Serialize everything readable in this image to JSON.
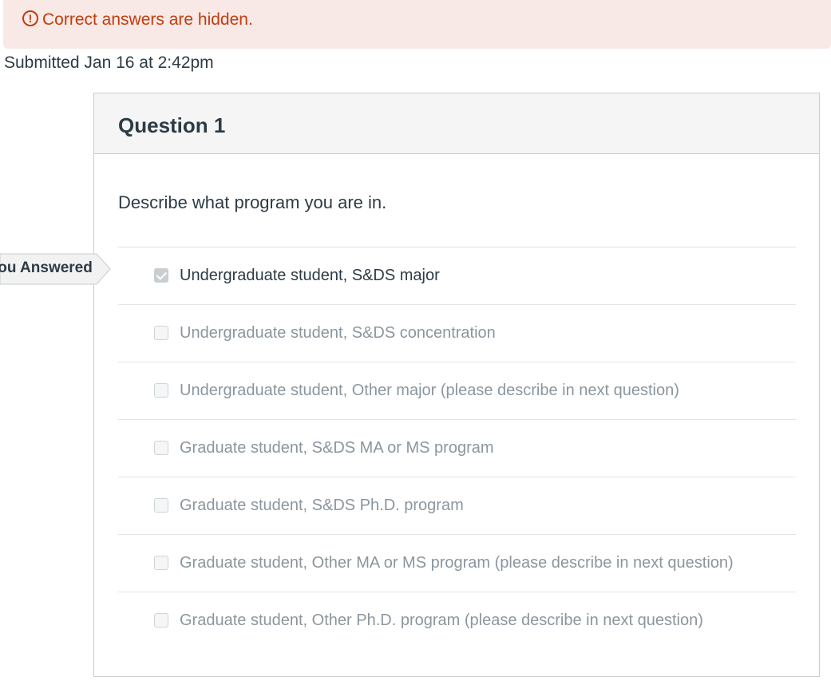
{
  "alert": {
    "icon": "warning-circle-icon",
    "message": "Correct answers are hidden.",
    "color": "#c23c0d",
    "background": "#f8e9e6"
  },
  "submission": {
    "text": "Submitted Jan 16 at 2:42pm"
  },
  "answered_tag": {
    "label": "You Answered"
  },
  "question": {
    "title": "Question 1",
    "prompt": "Describe what program you are in.",
    "answers": [
      {
        "label": "Undergraduate student, S&DS major",
        "checked": true
      },
      {
        "label": "Undergraduate student, S&DS concentration",
        "checked": false
      },
      {
        "label": "Undergraduate student, Other major (please describe in next question)",
        "checked": false
      },
      {
        "label": "Graduate student, S&DS MA or MS program",
        "checked": false
      },
      {
        "label": "Graduate student, S&DS Ph.D. program",
        "checked": false
      },
      {
        "label": "Graduate student, Other MA or MS program (please describe in next question)",
        "checked": false
      },
      {
        "label": "Graduate student, Other Ph.D. program (please describe in next question)",
        "checked": false
      }
    ]
  }
}
